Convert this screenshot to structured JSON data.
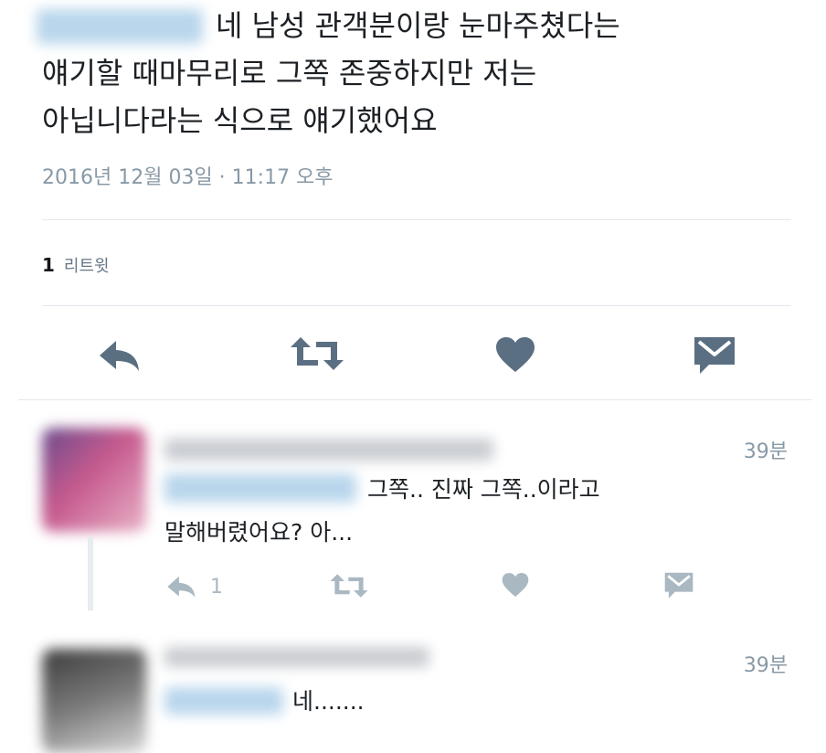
{
  "main_tweet": {
    "lines": [
      "네 남성 관객분이랑 눈마주쳤다는",
      "얘기할 때마무리로 그쪽 존중하지만 저는",
      "아닙니다라는 식으로 얘기했어요"
    ],
    "timestamp": "2016년 12월 03일 · 11:17 오후",
    "retweet_count": "1",
    "retweet_label": "리트윗"
  },
  "replies": [
    {
      "time": "39분",
      "text_line1": "그쪽.. 진짜 그쪽..이라고",
      "text_line2": "말해버렸어요? 아...",
      "reply_count": "1"
    },
    {
      "time": "39분",
      "text_line1": "네......."
    }
  ],
  "colors": {
    "icon": "#5b6f82",
    "icon_light": "#aab8c2",
    "mention_blur": "#b9d6ec",
    "divider": "#e1e8ed"
  },
  "icons": [
    "reply-icon",
    "retweet-icon",
    "like-icon",
    "message-icon"
  ]
}
